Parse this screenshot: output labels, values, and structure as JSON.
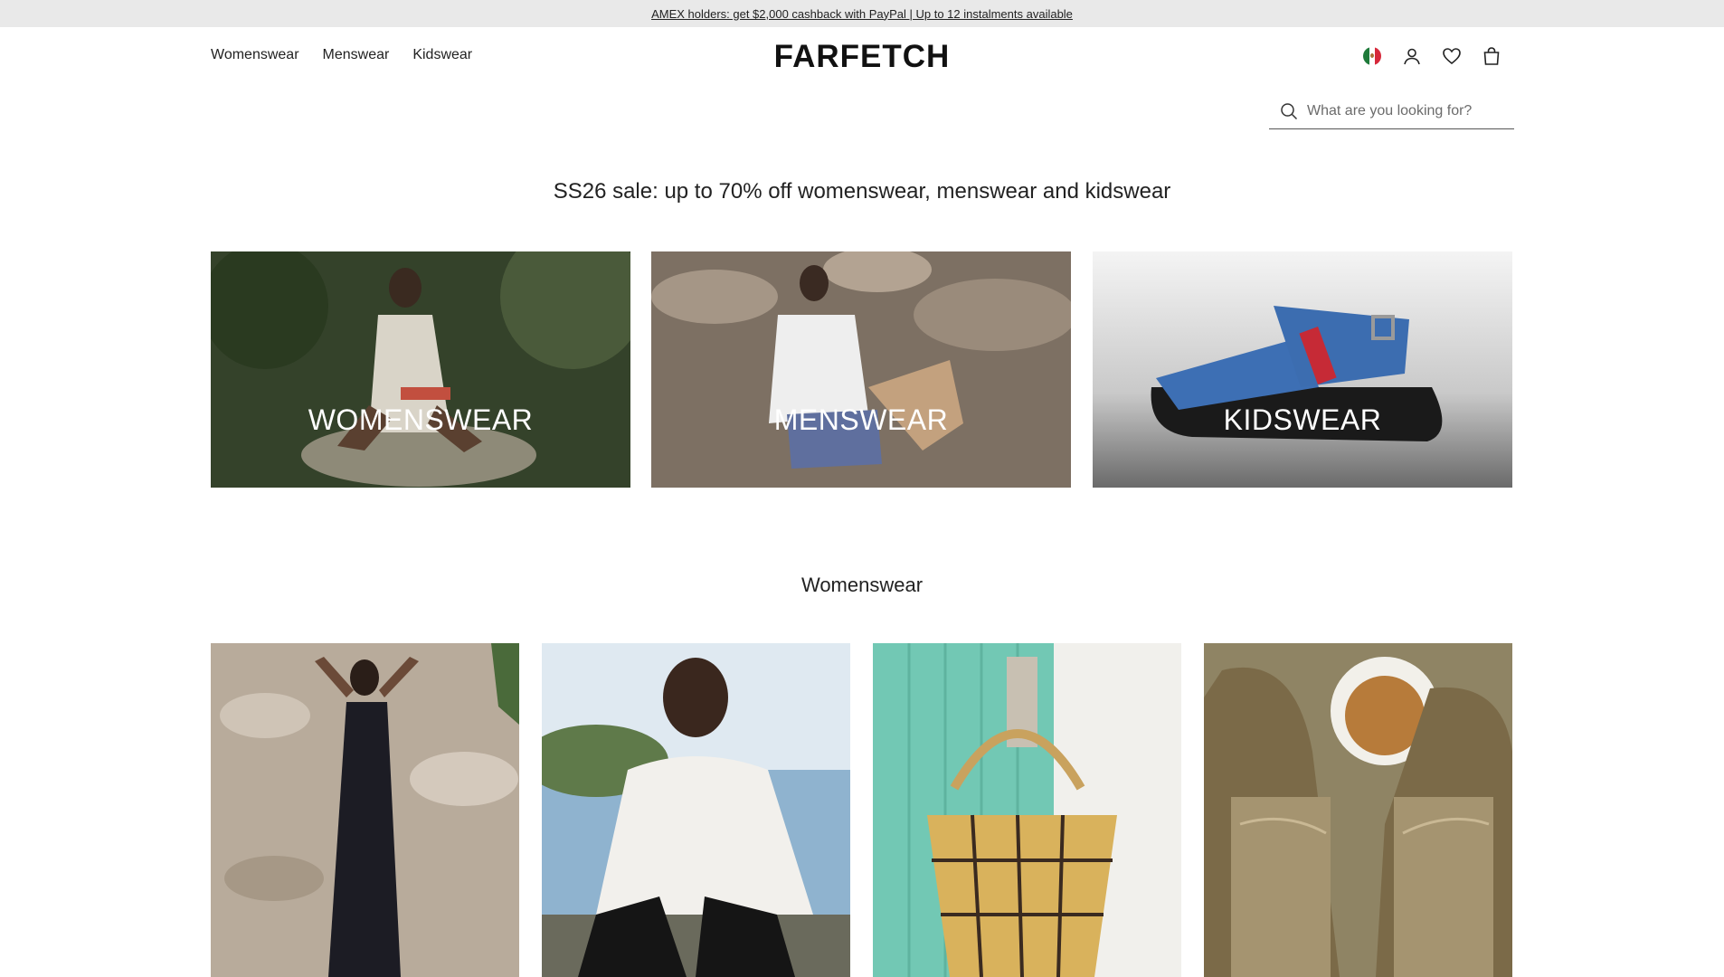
{
  "promo": {
    "text": "AMEX holders: get $2,000 cashback with PayPal | Up to 12 instalments available"
  },
  "header": {
    "nav": [
      {
        "label": "Womenswear"
      },
      {
        "label": "Menswear"
      },
      {
        "label": "Kidswear"
      }
    ],
    "logo": "FARFETCH",
    "icons": [
      "mexico-flag-icon",
      "account-icon",
      "wishlist-heart-icon",
      "shopping-bag-icon"
    ]
  },
  "search": {
    "placeholder": "What are you looking for?",
    "value": ""
  },
  "headline": "SS26 sale: up to 70% off womenswear, menswear and kidswear",
  "categories": [
    {
      "label": "WOMENSWEAR"
    },
    {
      "label": "MENSWEAR"
    },
    {
      "label": "KIDSWEAR"
    }
  ],
  "section": {
    "title": "Womenswear"
  },
  "colors": {
    "promo_bg": "#e9e9e9",
    "text": "#222222",
    "tile_label": "#ffffff"
  }
}
